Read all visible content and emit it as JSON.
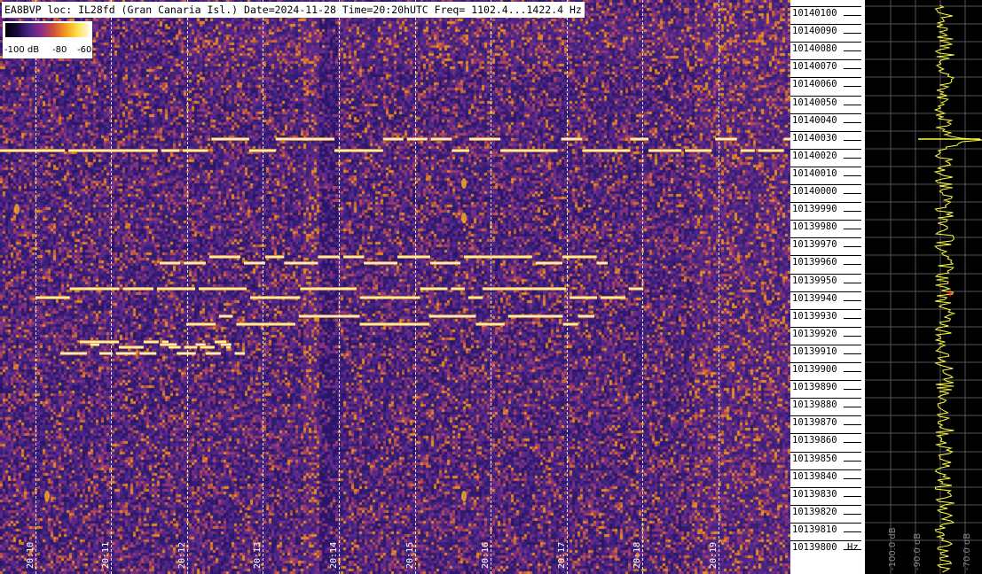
{
  "header": {
    "text": "EA8BVP loc: IL28fd (Gran Canaria Isl.) Date=2024-11-28 Time=20:20hUTC Freq= 1102.4...1422.4 Hz"
  },
  "legend": {
    "min_label": "-100 dB",
    "mid_label": "-80",
    "max_label": "-60"
  },
  "time_labels": [
    "20:10",
    "20:11",
    "20:12",
    "20:13",
    "20:14",
    "20:15",
    "20:16",
    "20:17",
    "20:18",
    "20:19"
  ],
  "freq_labels": [
    "10140100",
    "10140090",
    "10140080",
    "10140070",
    "10140060",
    "10140050",
    "10140040",
    "10140030",
    "10140020",
    "10140010",
    "10140000",
    "10139990",
    "10139980",
    "10139970",
    "10139960",
    "10139950",
    "10139940",
    "10139930",
    "10139920",
    "10139910",
    "10139900",
    "10139890",
    "10139880",
    "10139870",
    "10139860",
    "10139850",
    "10139840",
    "10139830",
    "10139820",
    "10139810",
    "10139800"
  ],
  "freq_unit": "Hz",
  "spectrum": {
    "db_labels": [
      "-100.0 dB",
      "-90.0 dB",
      "-70.0 dB"
    ],
    "trace_color": "#ffff40",
    "grid_color": "#555555",
    "marker_color": "#ff2020"
  },
  "colors": {
    "background": "#3a1e78",
    "signal_core": "#ffffff",
    "signal_glow": "#ffb020"
  }
}
